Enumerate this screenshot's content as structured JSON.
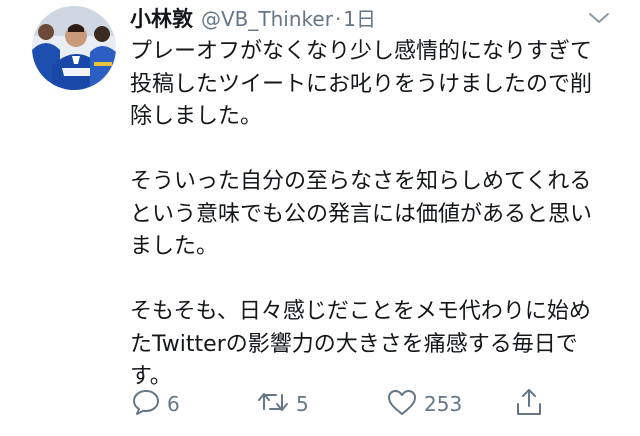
{
  "tweet": {
    "display_name": "小林敦",
    "handle": "@VB_Thinker",
    "separator": "·",
    "time": "1日",
    "paragraphs": [
      "プレーオフがなくなり少し感情的になりすぎて\n投稿したツイートにお叱りをうけましたので削\n除しました。",
      "そういった自分の至らなさを知らしめてくれる\nという意味でも公の発言には価値があると思い\nました。",
      "そもそも、日々感じだことをメモ代わりに始め\nたTwitterの影響力の大きさを痛感する毎日で\nす。"
    ]
  },
  "actions": {
    "reply_count": "6",
    "retweet_count": "5",
    "like_count": "253"
  },
  "icons": {
    "reply": "reply-icon",
    "retweet": "retweet-icon",
    "like": "heart-icon",
    "share": "share-icon",
    "caret": "chevron-down-icon"
  },
  "colors": {
    "text": "#14171a",
    "secondary": "#657786",
    "team_blue": "#1d4fb0"
  }
}
